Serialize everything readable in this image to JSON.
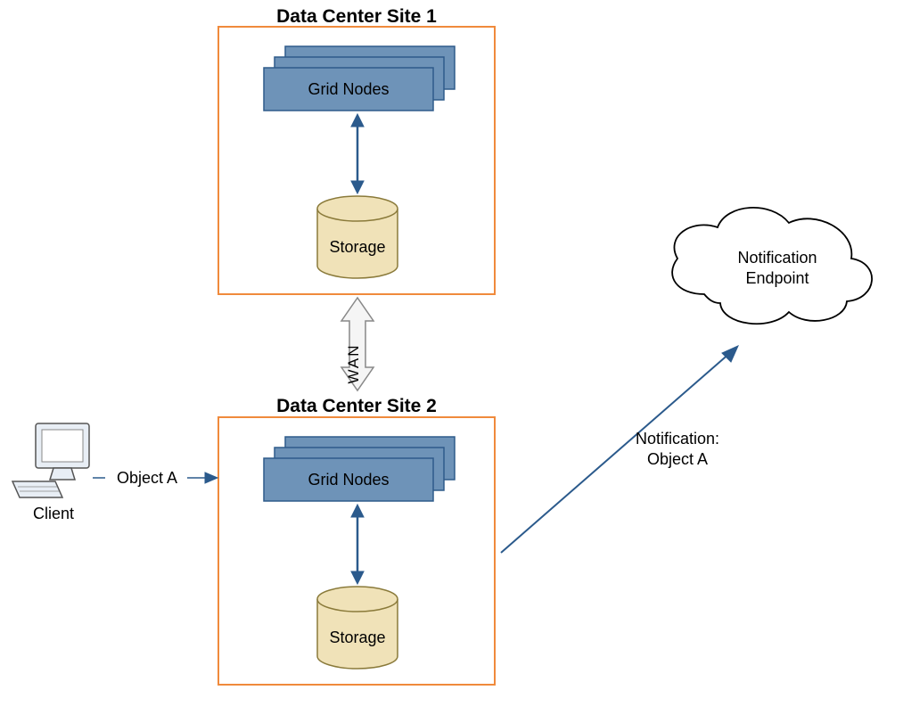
{
  "site1": {
    "title": "Data Center Site 1",
    "nodes_label": "Grid Nodes",
    "storage_label": "Storage"
  },
  "site2": {
    "title": "Data Center Site 2",
    "nodes_label": "Grid Nodes",
    "storage_label": "Storage"
  },
  "wan_label": "WAN",
  "client_label": "Client",
  "object_label": "Object A",
  "notification": {
    "line1": "Notification:",
    "line2": "Object A"
  },
  "endpoint": {
    "line1": "Notification",
    "line2": "Endpoint"
  },
  "colors": {
    "site_border": "#F08A3C",
    "node_fill": "#6E93B8",
    "node_stroke": "#2F5B8A",
    "storage_fill": "#F0E2B8",
    "storage_stroke": "#8A7A3A",
    "arrow": "#2B5A8C",
    "wan_fill": "#F5F5F5",
    "client_fill": "#E8EEF5"
  }
}
